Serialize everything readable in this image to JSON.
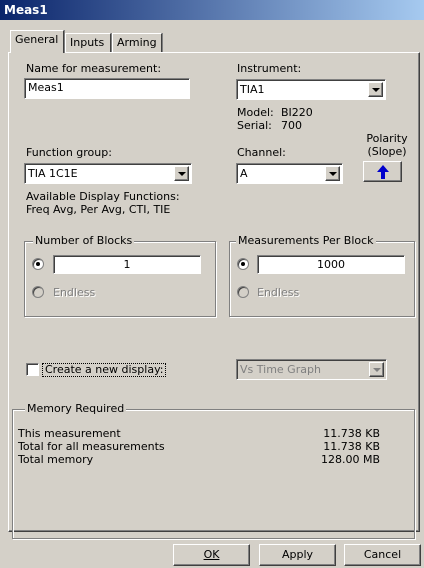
{
  "window": {
    "title": "Meas1"
  },
  "tabs": [
    {
      "label": "General",
      "active": true
    },
    {
      "label": "Inputs",
      "active": false
    },
    {
      "label": "Arming",
      "active": false
    }
  ],
  "general": {
    "name_label": "Name for measurement:",
    "name_value": "Meas1",
    "instrument_label": "Instrument:",
    "instrument_value": "TIA1",
    "model_label": "Model:",
    "model_value": "BI220",
    "serial_label": "Serial:",
    "serial_value": "700",
    "polarity_label_line1": "Polarity",
    "polarity_label_line2": "(Slope)",
    "function_group_label": "Function group:",
    "function_group_value": "TIA 1C1E",
    "channel_label": "Channel:",
    "channel_value": "A",
    "available_label": "Available Display Functions:",
    "available_functions": "Freq Avg, Per Avg, CTI, TIE"
  },
  "blocks": {
    "title": "Number of Blocks",
    "value": "1",
    "endless_label": "Endless"
  },
  "per_block": {
    "title": "Measurements Per Block",
    "value": "1000",
    "endless_label": "Endless"
  },
  "display": {
    "create_label": "Create a new display:",
    "checked": false,
    "type_value": "Vs Time Graph"
  },
  "memory": {
    "title": "Memory Required",
    "rows": [
      {
        "label": "This measurement",
        "value": "11.738 KB"
      },
      {
        "label": "Total for all measurements",
        "value": "11.738 KB"
      },
      {
        "label": "Total memory",
        "value": "128.00 MB"
      }
    ]
  },
  "buttons": {
    "ok": "OK",
    "apply": "Apply",
    "cancel": "Cancel"
  },
  "colors": {
    "face": "#d4d0c8",
    "title_start": "#0a246a",
    "title_end": "#a6caf0",
    "arrow": "#0000cc"
  }
}
